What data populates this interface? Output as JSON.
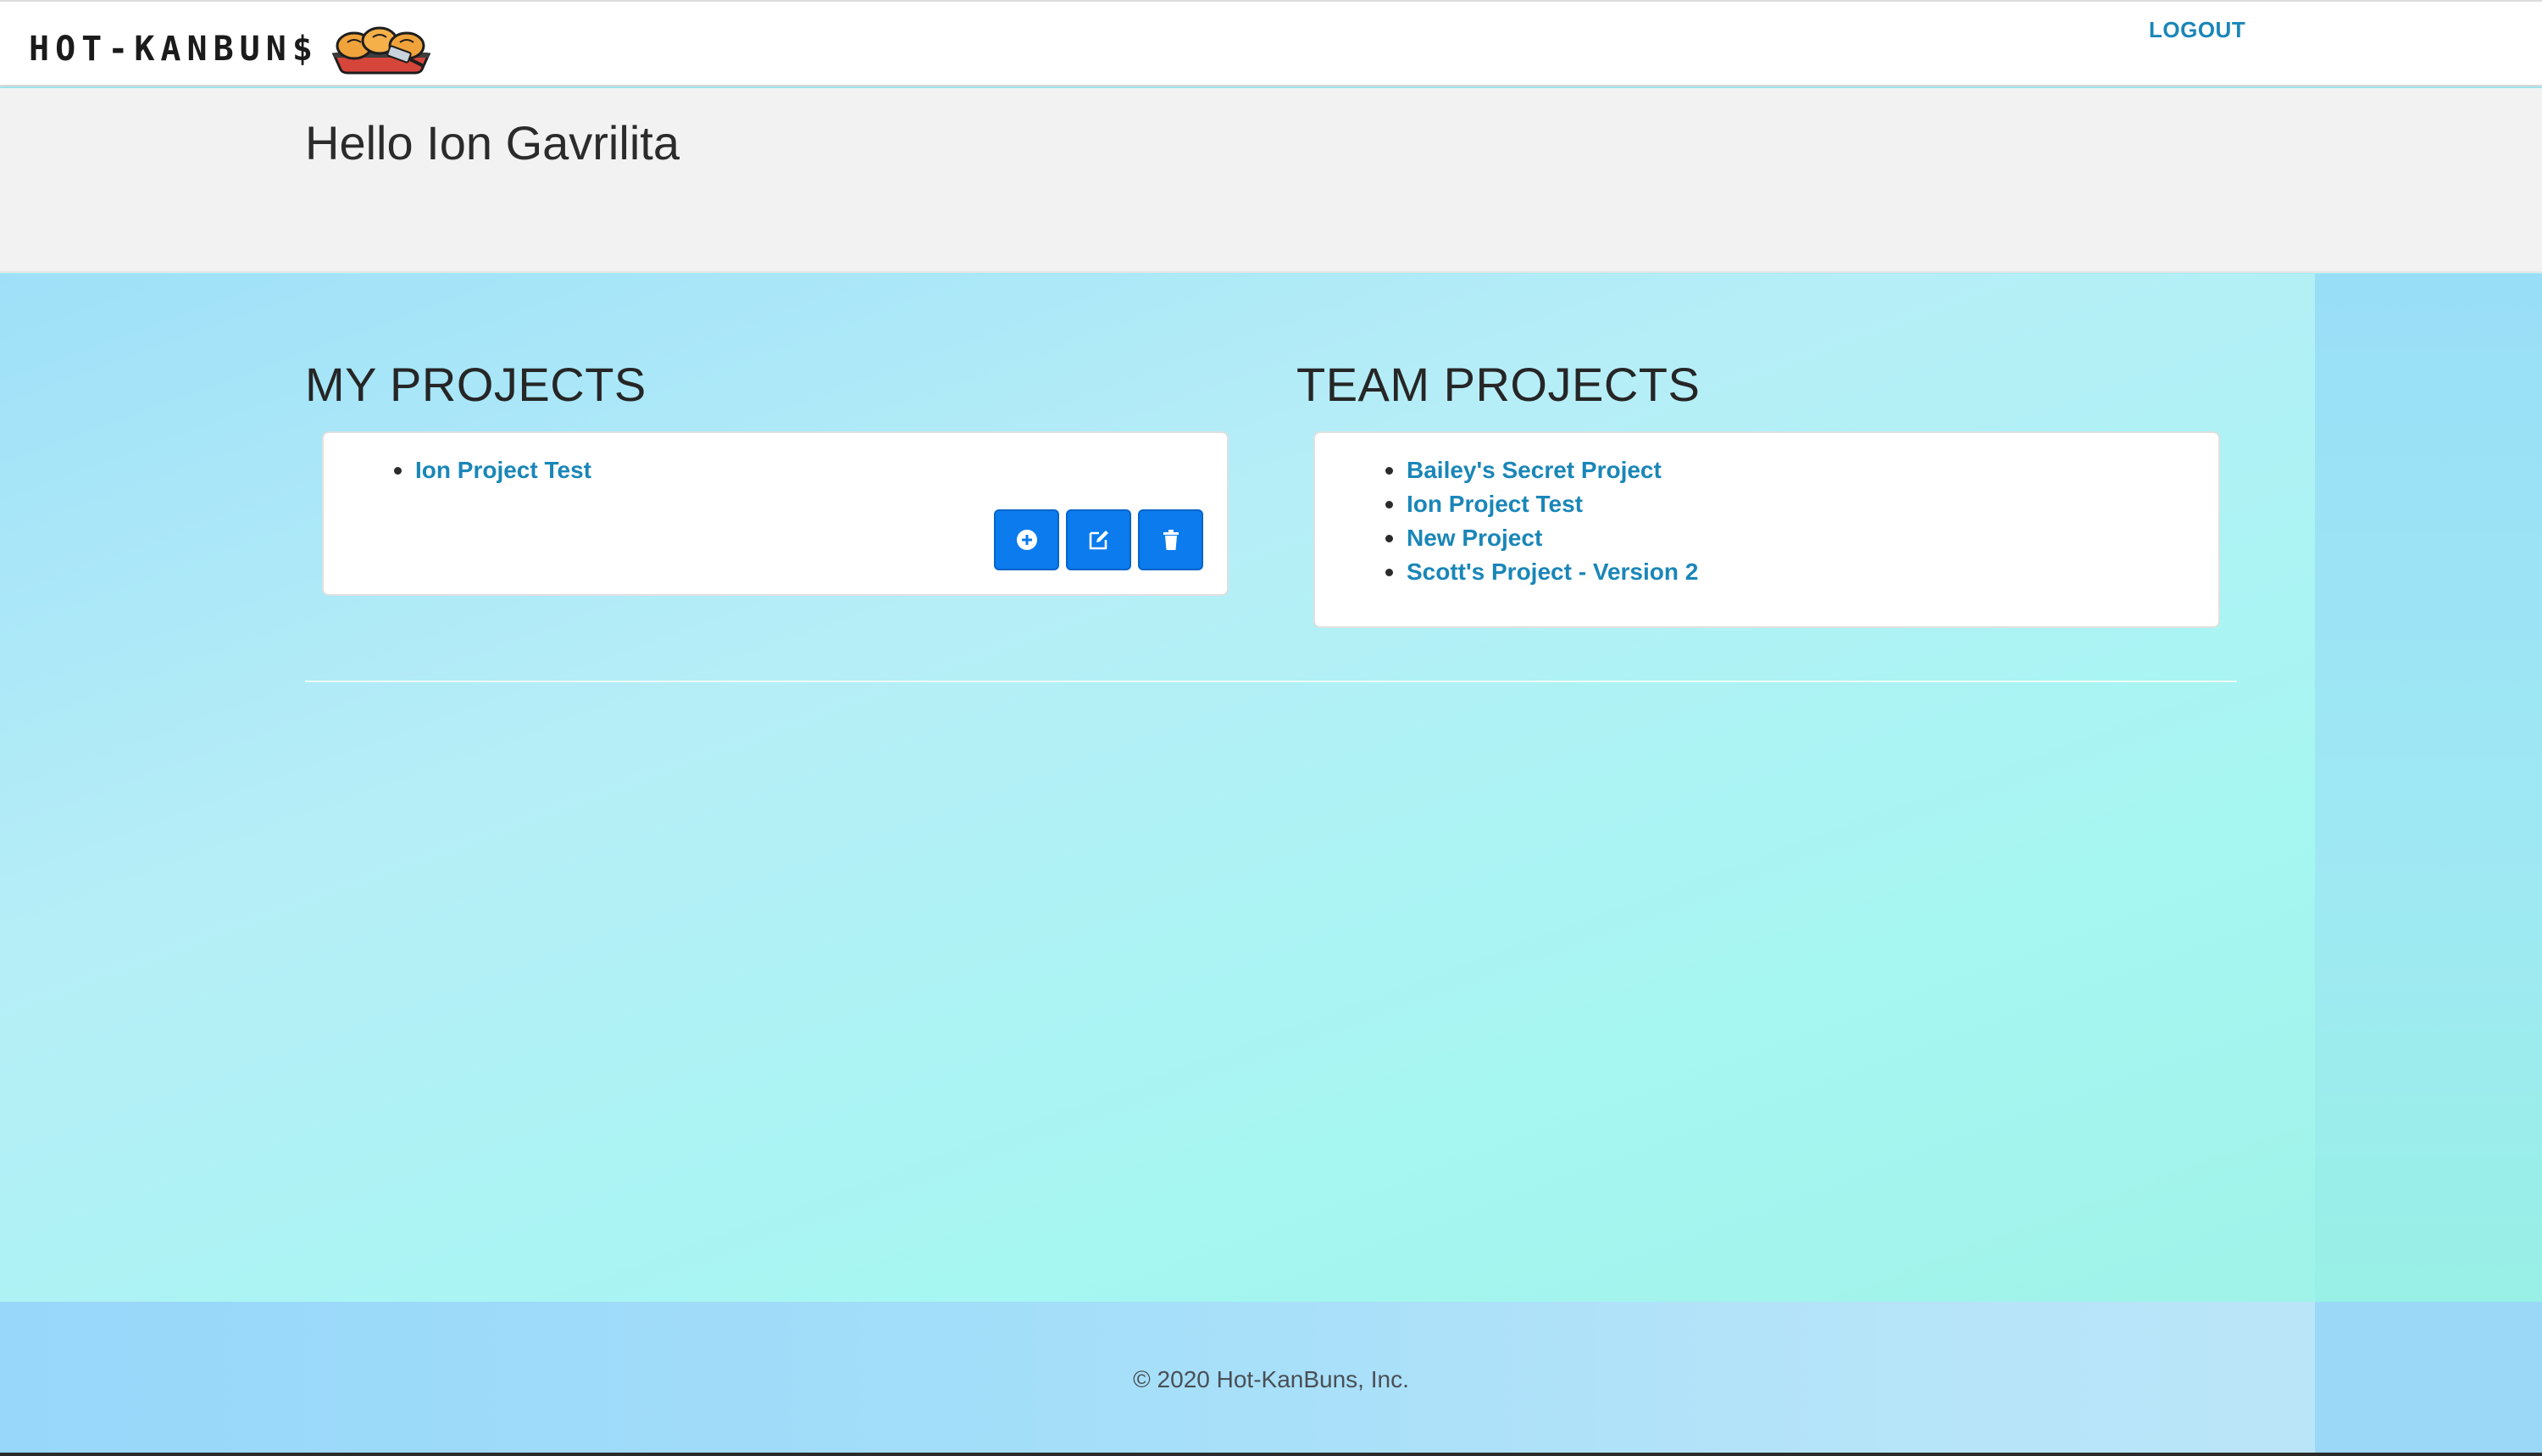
{
  "navbar": {
    "brand_text": "HOT-KANBUN$",
    "brand_logo": "hot-buns-basket-logo",
    "logout_label": "LOGOUT"
  },
  "jumbotron": {
    "greeting": "Hello Ion Gavrilita"
  },
  "my_projects": {
    "title": "MY PROJECTS",
    "items": [
      {
        "label": "Ion Project Test"
      }
    ],
    "buttons": [
      {
        "icon": "plus-circle-icon"
      },
      {
        "icon": "edit-icon"
      },
      {
        "icon": "trash-icon"
      }
    ]
  },
  "team_projects": {
    "title": "TEAM PROJECTS",
    "items": [
      {
        "label": "Bailey's Secret Project"
      },
      {
        "label": "Ion Project Test"
      },
      {
        "label": "New Project"
      },
      {
        "label": "Scott's Project - Version 2"
      }
    ]
  },
  "footer": {
    "copyright": "© 2020 Hot-KanBuns, Inc."
  },
  "colors": {
    "link": "#1a86b8",
    "button": "#0b7bee",
    "jumbotron": "#f2f2f2",
    "main_background_start": "#9fe0f8",
    "main_background_end": "#9ef2e6"
  }
}
